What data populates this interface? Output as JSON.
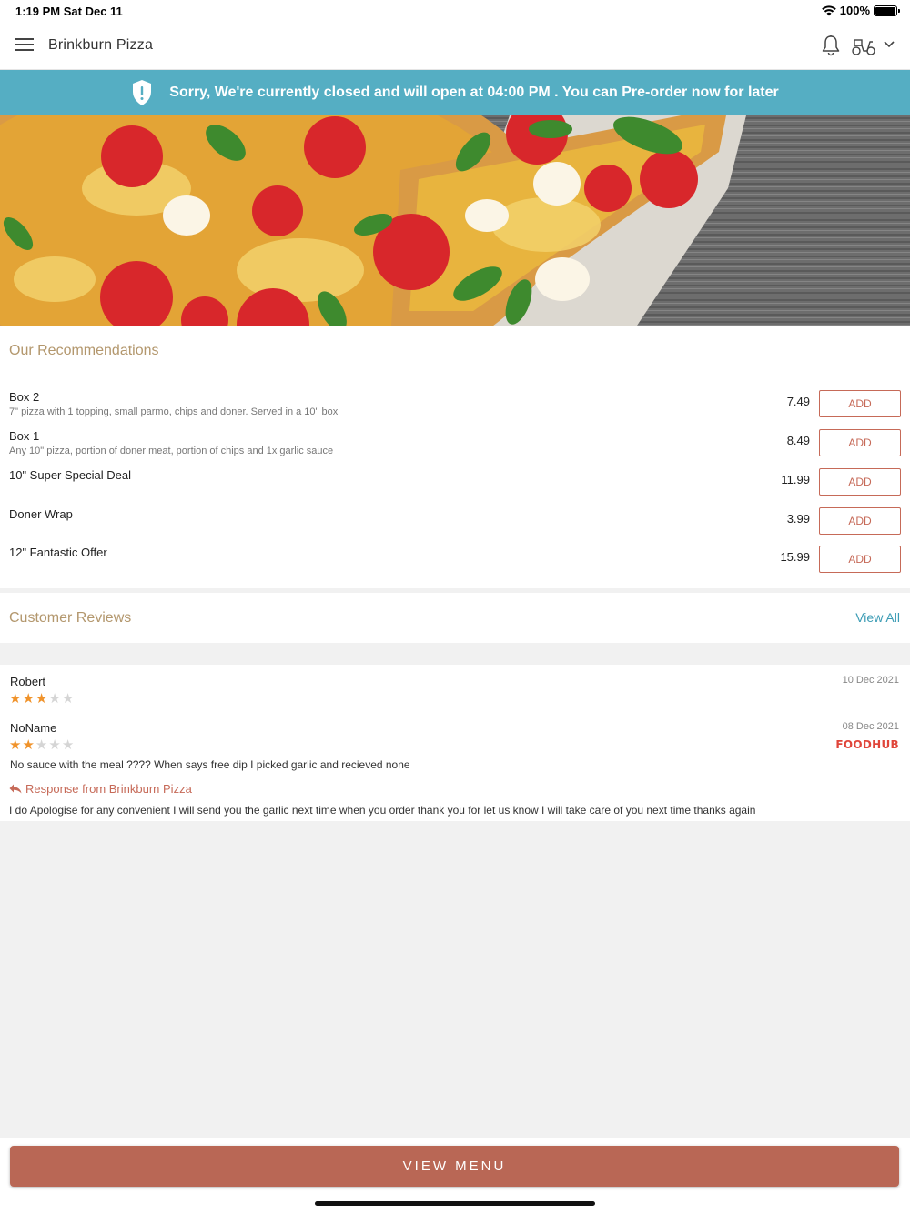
{
  "status_bar": {
    "time": "1:19 PM   Sat Dec 11",
    "battery_text": "100%"
  },
  "header": {
    "title": "Brinkburn Pizza"
  },
  "banner": {
    "message": "Sorry, We're currently closed and will open at 04:00 PM . You can Pre-order now for later"
  },
  "recommendations": {
    "title": "Our Recommendations",
    "add_label": "ADD",
    "items": [
      {
        "name": "Box 2",
        "desc": "7\" pizza with 1 topping, small parmo, chips and doner. Served in a 10\" box",
        "price": "7.49"
      },
      {
        "name": "Box 1",
        "desc": "Any 10\" pizza, portion of doner meat, portion of chips and 1x garlic sauce",
        "price": "8.49"
      },
      {
        "name": "10\" Super Special Deal",
        "desc": "",
        "price": "11.99"
      },
      {
        "name": "Doner Wrap",
        "desc": "",
        "price": "3.99"
      },
      {
        "name": "12\" Fantastic Offer",
        "desc": "",
        "price": "15.99"
      }
    ]
  },
  "reviews": {
    "title": "Customer Reviews",
    "view_all": "View All",
    "items": [
      {
        "name": "Robert",
        "date": "10 Dec 2021",
        "rating": 3
      },
      {
        "name": "NoName",
        "date": "08 Dec 2021",
        "rating": 2,
        "source": "FOODHUB",
        "text": "No sauce with the meal ???? When says free dip I picked garlic and recieved none",
        "response_label": "Response from Brinkburn Pizza",
        "response_text": "I do Apologise for any convenient I will send you the garlic next time when you order thank you for let us know I will take care of you next time thanks again"
      }
    ]
  },
  "footer": {
    "view_menu": "VIEW MENU"
  }
}
